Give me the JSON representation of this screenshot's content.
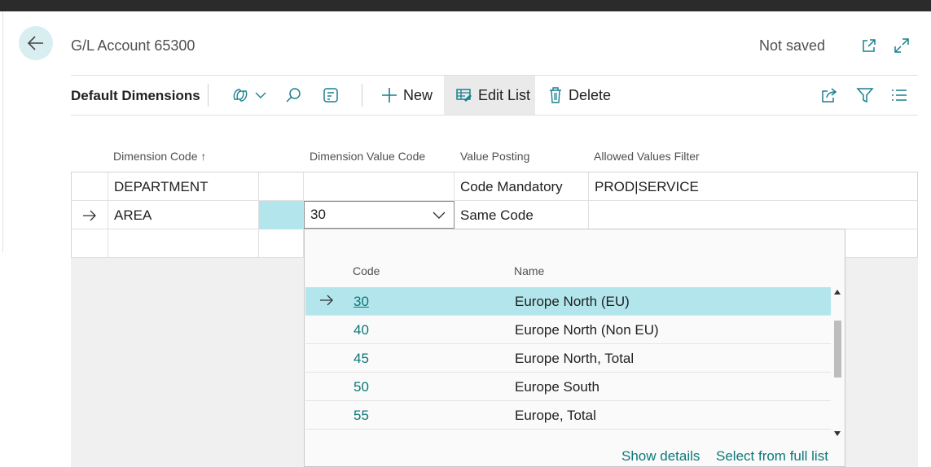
{
  "header": {
    "title": "G/L Account 65300",
    "status": "Not saved"
  },
  "toolbar": {
    "title": "Default Dimensions",
    "new_label": "New",
    "edit_list_label": "Edit List",
    "delete_label": "Delete"
  },
  "grid": {
    "columns": [
      "Dimension Code",
      "Dimension Value Code",
      "Value Posting",
      "Allowed Values Filter"
    ],
    "sort_indicator": "↑",
    "rows": [
      {
        "dimension_code": "DEPARTMENT",
        "dimension_value_code": "",
        "value_posting": "Code Mandatory",
        "allowed_values_filter": "PROD|SERVICE"
      },
      {
        "dimension_code": "AREA",
        "dimension_value_code": "30",
        "value_posting": "Same Code",
        "allowed_values_filter": ""
      }
    ]
  },
  "lookup": {
    "columns": [
      "Code",
      "Name"
    ],
    "rows": [
      {
        "code": "30",
        "name": "Europe North (EU)"
      },
      {
        "code": "40",
        "name": "Europe North (Non EU)"
      },
      {
        "code": "45",
        "name": "Europe North, Total"
      },
      {
        "code": "50",
        "name": "Europe South"
      },
      {
        "code": "55",
        "name": "Europe, Total"
      }
    ],
    "show_details": "Show details",
    "select_full_list": "Select from full list"
  },
  "colors": {
    "selection": "#b2e6ec",
    "link": "#0d7878",
    "accent": "#d9eef0"
  }
}
